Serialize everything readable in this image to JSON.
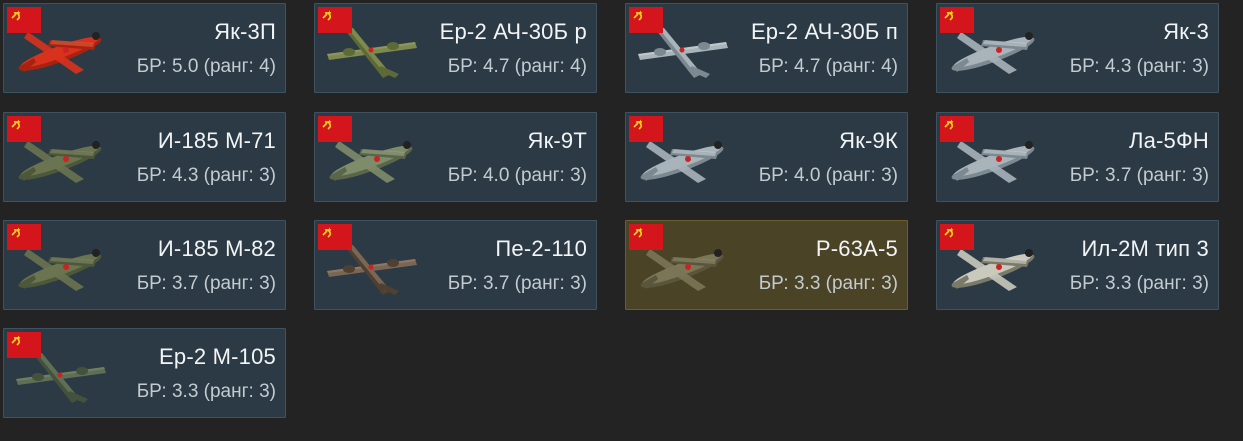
{
  "colors": {
    "background": "#232323",
    "card": "#2b3a44",
    "card_highlight": "#4a4326",
    "flag_red": "#d4161c",
    "flag_emblem": "#f6d61a"
  },
  "vehicles": [
    {
      "name": "Як-3П",
      "br": "БР: 5.0 (ранг: 4)",
      "flag_icon": "ussr-flag-icon",
      "plane_icon": "yak-3p-plane-icon",
      "camo": "red"
    },
    {
      "name": "Ер-2 АЧ-30Б р",
      "br": "БР: 4.7 (ранг: 4)",
      "flag_icon": "ussr-flag-icon",
      "plane_icon": "er-2-plane-icon",
      "camo": "green-brown"
    },
    {
      "name": "Ер-2 АЧ-30Б п",
      "br": "БР: 4.7 (ранг: 4)",
      "flag_icon": "ussr-flag-icon",
      "plane_icon": "er-2-plane-icon",
      "camo": "grey"
    },
    {
      "name": "Як-3",
      "br": "БР: 4.3 (ранг: 3)",
      "flag_icon": "ussr-flag-icon",
      "plane_icon": "yak-3-plane-icon",
      "camo": "grey"
    },
    {
      "name": "И-185 М-71",
      "br": "БР: 4.3 (ранг: 3)",
      "flag_icon": "ussr-flag-icon",
      "plane_icon": "i-185-plane-icon",
      "camo": "olive"
    },
    {
      "name": "Як-9Т",
      "br": "БР: 4.0 (ранг: 3)",
      "flag_icon": "ussr-flag-icon",
      "plane_icon": "yak-9t-plane-icon",
      "camo": "green-grey"
    },
    {
      "name": "Як-9К",
      "br": "БР: 4.0 (ранг: 3)",
      "flag_icon": "ussr-flag-icon",
      "plane_icon": "yak-9k-plane-icon",
      "camo": "grey"
    },
    {
      "name": "Ла-5ФН",
      "br": "БР: 3.7 (ранг: 3)",
      "flag_icon": "ussr-flag-icon",
      "plane_icon": "la-5fn-plane-icon",
      "camo": "grey"
    },
    {
      "name": "И-185 М-82",
      "br": "БР: 3.7 (ранг: 3)",
      "flag_icon": "ussr-flag-icon",
      "plane_icon": "i-185-plane-icon",
      "camo": "olive"
    },
    {
      "name": "Пе-2-110",
      "br": "БР: 3.7 (ранг: 3)",
      "flag_icon": "ussr-flag-icon",
      "plane_icon": "pe-2-plane-icon",
      "camo": "brown"
    },
    {
      "name": "Р-63А-5",
      "br": "БР: 3.3 (ранг: 3)",
      "flag_icon": "ussr-flag-icon",
      "plane_icon": "p-63-plane-icon",
      "camo": "olive-drab",
      "highlighted": true
    },
    {
      "name": "Ил-2М тип 3",
      "br": "БР: 3.3 (ранг: 3)",
      "flag_icon": "ussr-flag-icon",
      "plane_icon": "il-2m-plane-icon",
      "camo": "winter"
    },
    {
      "name": "Ер-2 М-105",
      "br": "БР: 3.3 (ранг: 3)",
      "flag_icon": "ussr-flag-icon",
      "plane_icon": "er-2-plane-icon",
      "camo": "green"
    }
  ]
}
